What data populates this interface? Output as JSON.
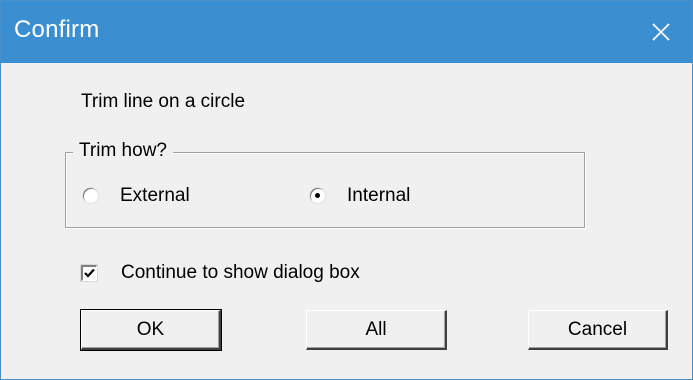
{
  "dialog": {
    "title": "Confirm",
    "message": "Trim line on a circle"
  },
  "trim_group": {
    "legend": "Trim how?",
    "options": [
      {
        "label": "External",
        "selected": false
      },
      {
        "label": "Internal",
        "selected": true
      }
    ]
  },
  "continue_checkbox": {
    "label": "Continue to show dialog box",
    "checked": true
  },
  "buttons": {
    "ok_label": "OK",
    "all_label": "All",
    "cancel_label": "Cancel"
  },
  "colors": {
    "titlebar": "#3b8fd0",
    "dialog_bg": "#f0f0f0"
  },
  "icons": {
    "close": "close-icon",
    "check": "check-icon"
  }
}
